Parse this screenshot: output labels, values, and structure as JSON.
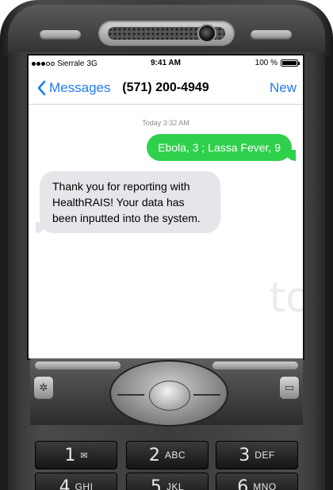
{
  "status_bar": {
    "carrier": "Sierrale",
    "network": "3G",
    "time": "9:41 AM",
    "battery_pct": "100 %",
    "battery_level": 1.0,
    "signal_bars_filled": 3,
    "signal_bars_total": 5
  },
  "nav": {
    "back_label": "Messages",
    "title": "(571) 200-4949",
    "new_label": "New"
  },
  "conversation": {
    "timestamp": "Today 3:32 AM",
    "messages": [
      {
        "direction": "outgoing",
        "text": "Ebola, 3 ; Lassa Fever, 9"
      },
      {
        "direction": "incoming",
        "text": "Thank you for reporting with HealthRAIS! Your data has been inputted into the system."
      }
    ]
  },
  "watermark": "to",
  "keypad": {
    "keys": [
      {
        "digit": "1",
        "letters": "",
        "icon": "voicemail-icon"
      },
      {
        "digit": "2",
        "letters": "ABC"
      },
      {
        "digit": "3",
        "letters": "DEF"
      },
      {
        "digit": "4",
        "letters": "GHI"
      },
      {
        "digit": "5",
        "letters": "JKL"
      },
      {
        "digit": "6",
        "letters": "MNO"
      }
    ]
  },
  "colors": {
    "ios_blue": "#1f7bf6",
    "outgoing_bubble": "#2fd04b",
    "incoming_bubble": "#e5e5ea"
  }
}
